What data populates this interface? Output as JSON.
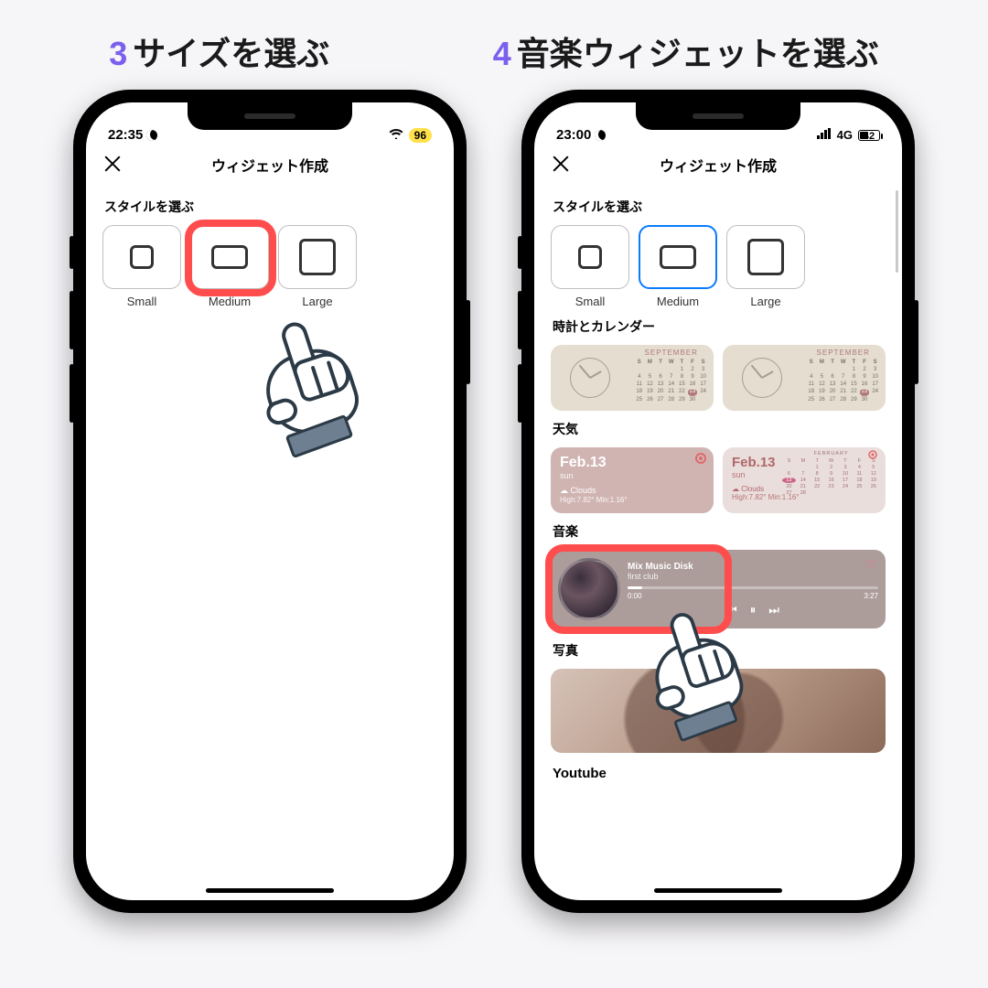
{
  "captions": {
    "step3_num": "3",
    "step3_text": "サイズを選ぶ",
    "step4_num": "4",
    "step4_text": "音楽ウィジェットを選ぶ"
  },
  "phone_left": {
    "status": {
      "time": "22:35",
      "battery": "96"
    },
    "nav_title": "ウィジェット作成",
    "style_label": "スタイルを選ぶ",
    "sizes": {
      "small": "Small",
      "medium": "Medium",
      "large": "Large"
    }
  },
  "phone_right": {
    "status": {
      "time": "23:00",
      "network": "4G",
      "battery": "42"
    },
    "nav_title": "ウィジェット作成",
    "style_label": "スタイルを選ぶ",
    "sizes": {
      "small": "Small",
      "medium": "Medium",
      "large": "Large"
    },
    "sections": {
      "clock": "時計とカレンダー",
      "weather": "天気",
      "music": "音楽",
      "photo": "写真",
      "youtube": "Youtube"
    },
    "calendar": {
      "month": "SEPTEMBER",
      "dow": [
        "S",
        "M",
        "T",
        "W",
        "T",
        "F",
        "S"
      ],
      "today": 23
    },
    "weather": {
      "date": "Feb.13",
      "day": "sun",
      "cond": "☁ Clouds",
      "hilo": "High:7.82° Min:1.16°",
      "mini_month": "FEBRUARY"
    },
    "music": {
      "title": "Mix Music Disk",
      "artist": "first club",
      "t0": "0:00",
      "t1": "3:27"
    }
  }
}
